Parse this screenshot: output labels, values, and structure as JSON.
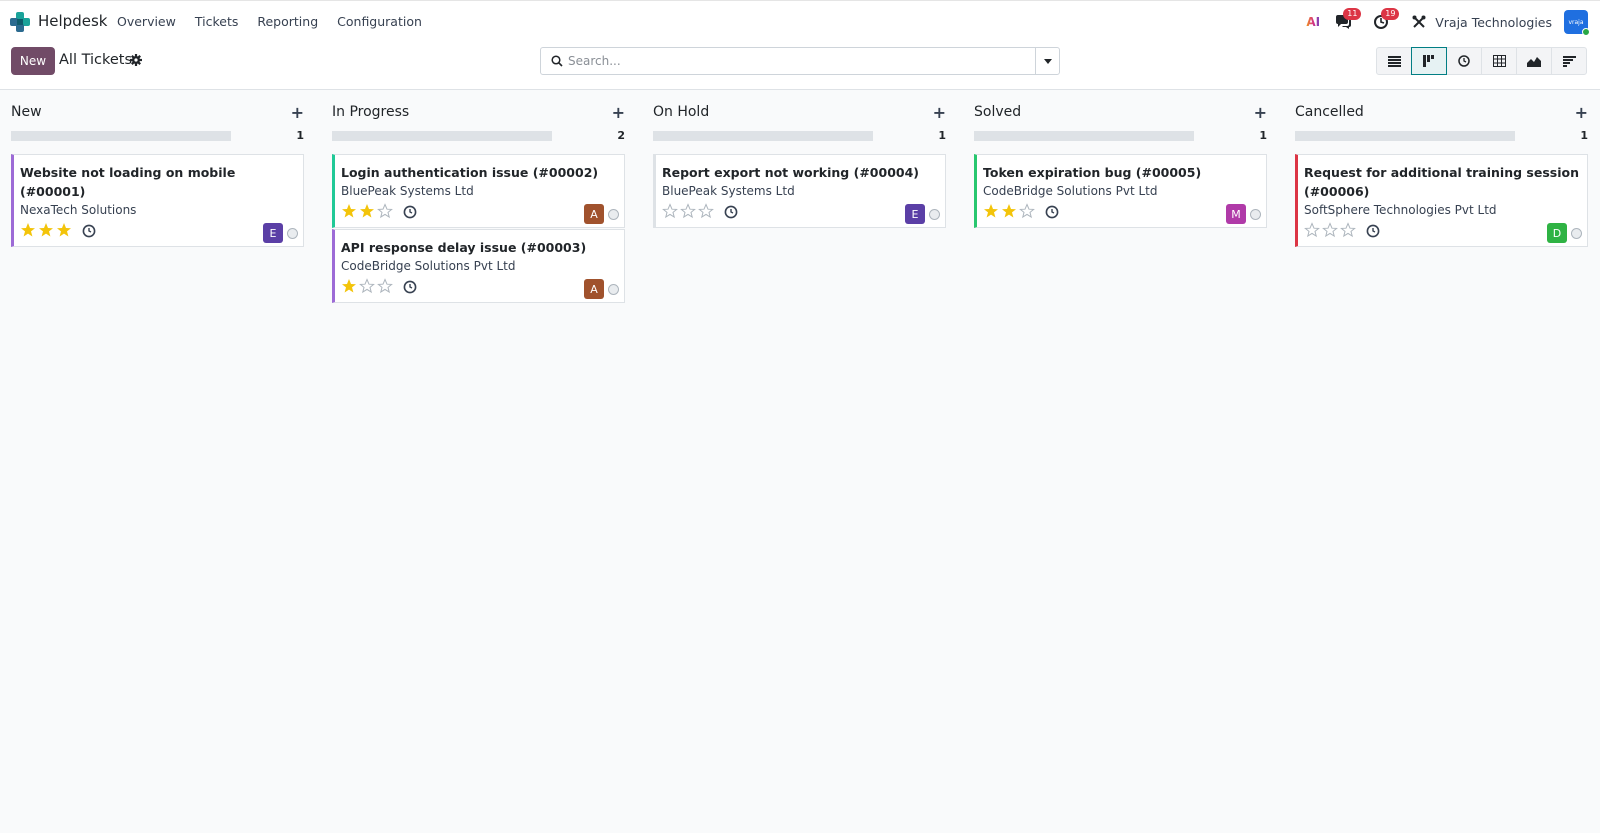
{
  "app": {
    "name": "Helpdesk"
  },
  "menu": [
    "Overview",
    "Tickets",
    "Reporting",
    "Configuration"
  ],
  "systray": {
    "ai_label": "AI",
    "messages_count": "11",
    "activities_count": "19",
    "company": "Vraja Technologies",
    "company_avatar": "vraja"
  },
  "control": {
    "new_label": "New",
    "breadcrumb": "All Tickets",
    "search_placeholder": "Search..."
  },
  "views": [
    "list-view-icon",
    "kanban-view-icon",
    "activity-view-icon",
    "pivot-view-icon",
    "graph-view-icon",
    "cohort-view-icon"
  ],
  "columns": [
    {
      "title": "New",
      "count": "1",
      "cards": [
        {
          "title": "Website not loading on mobile (#00001)",
          "partner": "NexaTech Solutions",
          "stars": 3,
          "user": "E",
          "user_color": "#5b3fa6",
          "accent": "#9d6bd6"
        }
      ]
    },
    {
      "title": "In Progress",
      "count": "2",
      "cards": [
        {
          "title": "Login authentication issue (#00002)",
          "partner": "BluePeak Systems Ltd",
          "stars": 2,
          "user": "A",
          "user_color": "#a0522d",
          "accent": "#20c997"
        },
        {
          "title": "API response delay issue (#00003)",
          "partner": "CodeBridge Solutions Pvt Ltd",
          "stars": 1,
          "user": "A",
          "user_color": "#a0522d",
          "accent": "#9d6bd6"
        }
      ]
    },
    {
      "title": "On Hold",
      "count": "1",
      "cards": [
        {
          "title": "Report export not working (#00004)",
          "partner": "BluePeak Systems Ltd",
          "stars": 0,
          "user": "E",
          "user_color": "#5b3fa6",
          "accent": "#dee2e6"
        }
      ]
    },
    {
      "title": "Solved",
      "count": "1",
      "cards": [
        {
          "title": "Token expiration bug (#00005)",
          "partner": "CodeBridge Solutions Pvt Ltd",
          "stars": 2,
          "user": "M",
          "user_color": "#b03aa8",
          "accent": "#28c76f"
        }
      ]
    },
    {
      "title": "Cancelled",
      "count": "1",
      "cards": [
        {
          "title": "Request for additional training session (#00006)",
          "partner": "SoftSphere Technologies Pvt Ltd",
          "stars": 0,
          "user": "D",
          "user_color": "#2fb344",
          "accent": "#dc3545"
        }
      ]
    }
  ]
}
